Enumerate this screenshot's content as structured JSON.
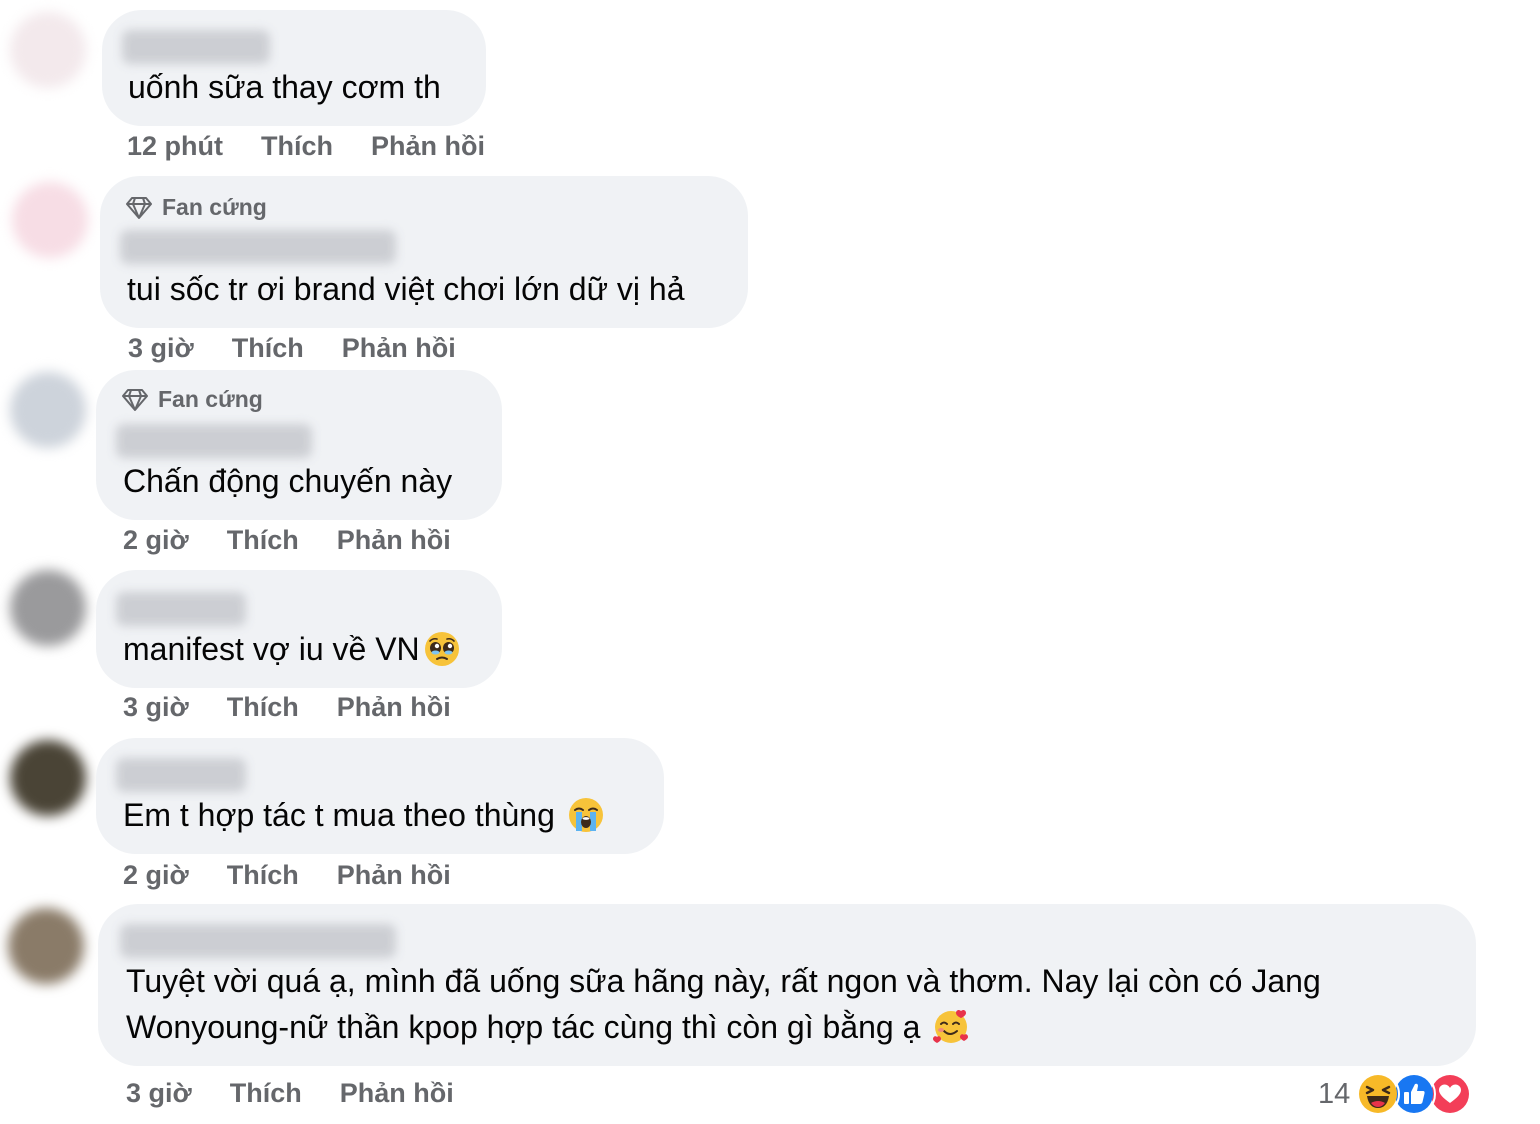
{
  "comments": [
    {
      "badge": "",
      "text": "uốnh sữa thay cơm th",
      "time": "12 phút",
      "like_label": "Thích",
      "reply_label": "Phản hồi"
    },
    {
      "badge": "Fan cứng",
      "text": "tui sốc tr ơi brand việt chơi lớn dữ vị hả",
      "time": "3 giờ",
      "like_label": "Thích",
      "reply_label": "Phản hồi"
    },
    {
      "badge": "Fan cứng",
      "text": "Chấn động chuyến này",
      "time": "2 giờ",
      "like_label": "Thích",
      "reply_label": "Phản hồi"
    },
    {
      "badge": "",
      "text": "manifest vợ iu về VN",
      "emoji": "pleading-face",
      "time": "3 giờ",
      "like_label": "Thích",
      "reply_label": "Phản hồi"
    },
    {
      "badge": "",
      "text": "Em t hợp tác t mua theo thùng ",
      "emoji": "crying-face",
      "time": "2 giờ",
      "like_label": "Thích",
      "reply_label": "Phản hồi"
    },
    {
      "badge": "",
      "text_line1": "Tuyệt vời quá ạ, mình đã uống sữa hãng này, rất ngon và thơm. Nay lại còn có Jang",
      "text_line2": "Wonyoung-nữ thần kpop hợp tác cùng thì còn gì bằng ạ ",
      "emoji": "smiling-face-with-hearts",
      "time": "3 giờ",
      "like_label": "Thích",
      "reply_label": "Phản hồi",
      "reaction_count": "14",
      "reactions": [
        "haha",
        "like",
        "love"
      ]
    }
  ],
  "colors": {
    "bubble": "#f0f2f5",
    "meta_text": "#65676b",
    "like_blue": "#1877f2",
    "love_red": "#f33e58",
    "haha_yellow": "#f7b928"
  }
}
